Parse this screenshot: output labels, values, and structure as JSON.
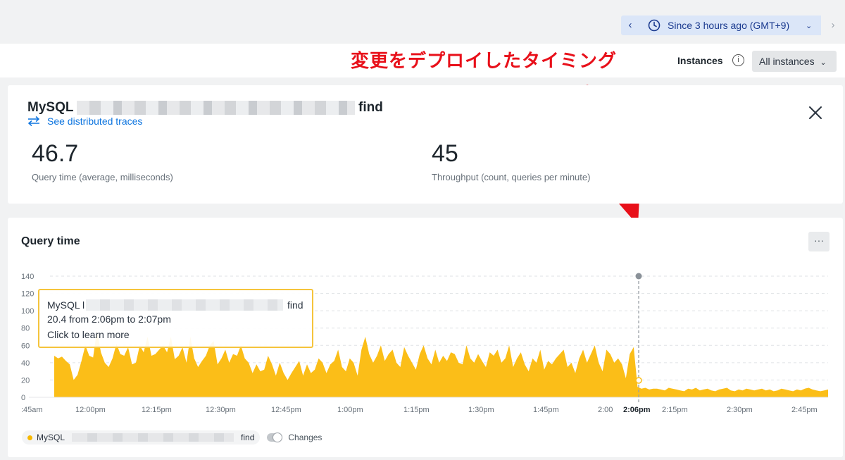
{
  "time_picker": {
    "prev_icon": "chevron-left-icon",
    "clock_icon": "clock-icon",
    "label": "Since 3 hours ago (GMT+9)",
    "dropdown_icon": "chevron-down-icon",
    "next_icon": "chevron-right-icon"
  },
  "annotation": {
    "text": "変更をデプロイしたタイミング",
    "color": "#e8101a"
  },
  "instances": {
    "label": "Instances",
    "info_icon": "info-icon",
    "selected": "All instances"
  },
  "detail": {
    "db_label": "MySQL",
    "operation": "find",
    "trace_link": "See distributed traces",
    "metrics": [
      {
        "value": "46.7",
        "label": "Query time (average, milliseconds)"
      },
      {
        "value": "45",
        "label": "Throughput (count, queries per minute)"
      }
    ]
  },
  "chart_panel": {
    "title": "Query time",
    "more_label": "···",
    "tooltip": {
      "line1_prefix": "MySQL l",
      "line1_suffix": "find",
      "line2": "20.4 from 2:06pm to 2:07pm",
      "line3": "Click to learn more"
    },
    "legend": {
      "series_prefix": "MySQL",
      "series_suffix": "find",
      "changes_label": "Changes"
    }
  },
  "chart_data": {
    "type": "area",
    "title": "Query time",
    "xlabel": "",
    "ylabel": "",
    "ylim": [
      0,
      140
    ],
    "y_ticks": [
      "0",
      "20",
      "40",
      "60",
      "80",
      "100",
      "120",
      "140"
    ],
    "x_ticks": [
      ":45am",
      "12:00pm",
      "12:15pm",
      "12:30pm",
      "12:45pm",
      "1:00pm",
      "1:15pm",
      "1:30pm",
      "1:45pm",
      "2:00",
      "2:06pm",
      "2:15pm",
      "2:30pm",
      "2:45pm"
    ],
    "highlight_x_tick": "2:06pm",
    "marker_time": "2:06pm",
    "color": "#fbbe18",
    "grid": "horizontal-dashed",
    "x_start_min": 11.66,
    "x_end_min": 62.5,
    "series": [
      {
        "values": [
          48,
          45,
          47,
          42,
          38,
          20,
          26,
          42,
          60,
          48,
          46,
          78,
          52,
          40,
          35,
          45,
          62,
          50,
          48,
          58,
          38,
          40,
          60,
          52,
          70,
          48,
          50,
          55,
          60,
          52,
          70,
          44,
          48,
          58,
          40,
          70,
          45,
          35,
          42,
          48,
          60,
          65,
          38,
          45,
          55,
          40,
          50,
          48,
          60,
          45,
          40,
          28,
          38,
          30,
          32,
          48,
          38,
          25,
          40,
          28,
          20,
          28,
          35,
          42,
          25,
          38,
          28,
          32,
          45,
          40,
          28,
          38,
          42,
          55,
          35,
          30,
          45,
          40,
          25,
          55,
          70,
          50,
          40,
          48,
          60,
          42,
          50,
          55,
          40,
          35,
          58,
          48,
          40,
          32,
          50,
          60,
          45,
          38,
          55,
          40,
          48,
          42,
          52,
          50,
          40,
          38,
          60,
          45,
          40,
          50,
          42,
          35,
          52,
          48,
          55,
          40,
          45,
          60,
          35,
          45,
          52,
          38,
          30,
          45,
          40,
          55,
          32,
          42,
          38,
          45,
          50,
          55,
          35,
          40,
          28,
          45,
          55,
          40,
          50,
          60,
          40,
          30,
          55,
          50,
          40,
          45,
          38,
          22,
          50,
          58,
          12,
          10,
          11,
          9,
          10,
          10,
          9,
          8,
          11,
          10,
          9,
          8,
          7,
          10,
          9,
          11,
          8,
          9,
          10,
          8,
          7,
          9,
          10,
          11,
          8,
          7,
          9,
          8,
          10,
          9,
          8,
          9,
          10,
          8,
          9,
          7,
          8,
          10,
          9,
          8,
          7,
          9,
          8,
          10,
          11,
          9,
          8,
          7,
          8,
          9
        ]
      }
    ]
  }
}
